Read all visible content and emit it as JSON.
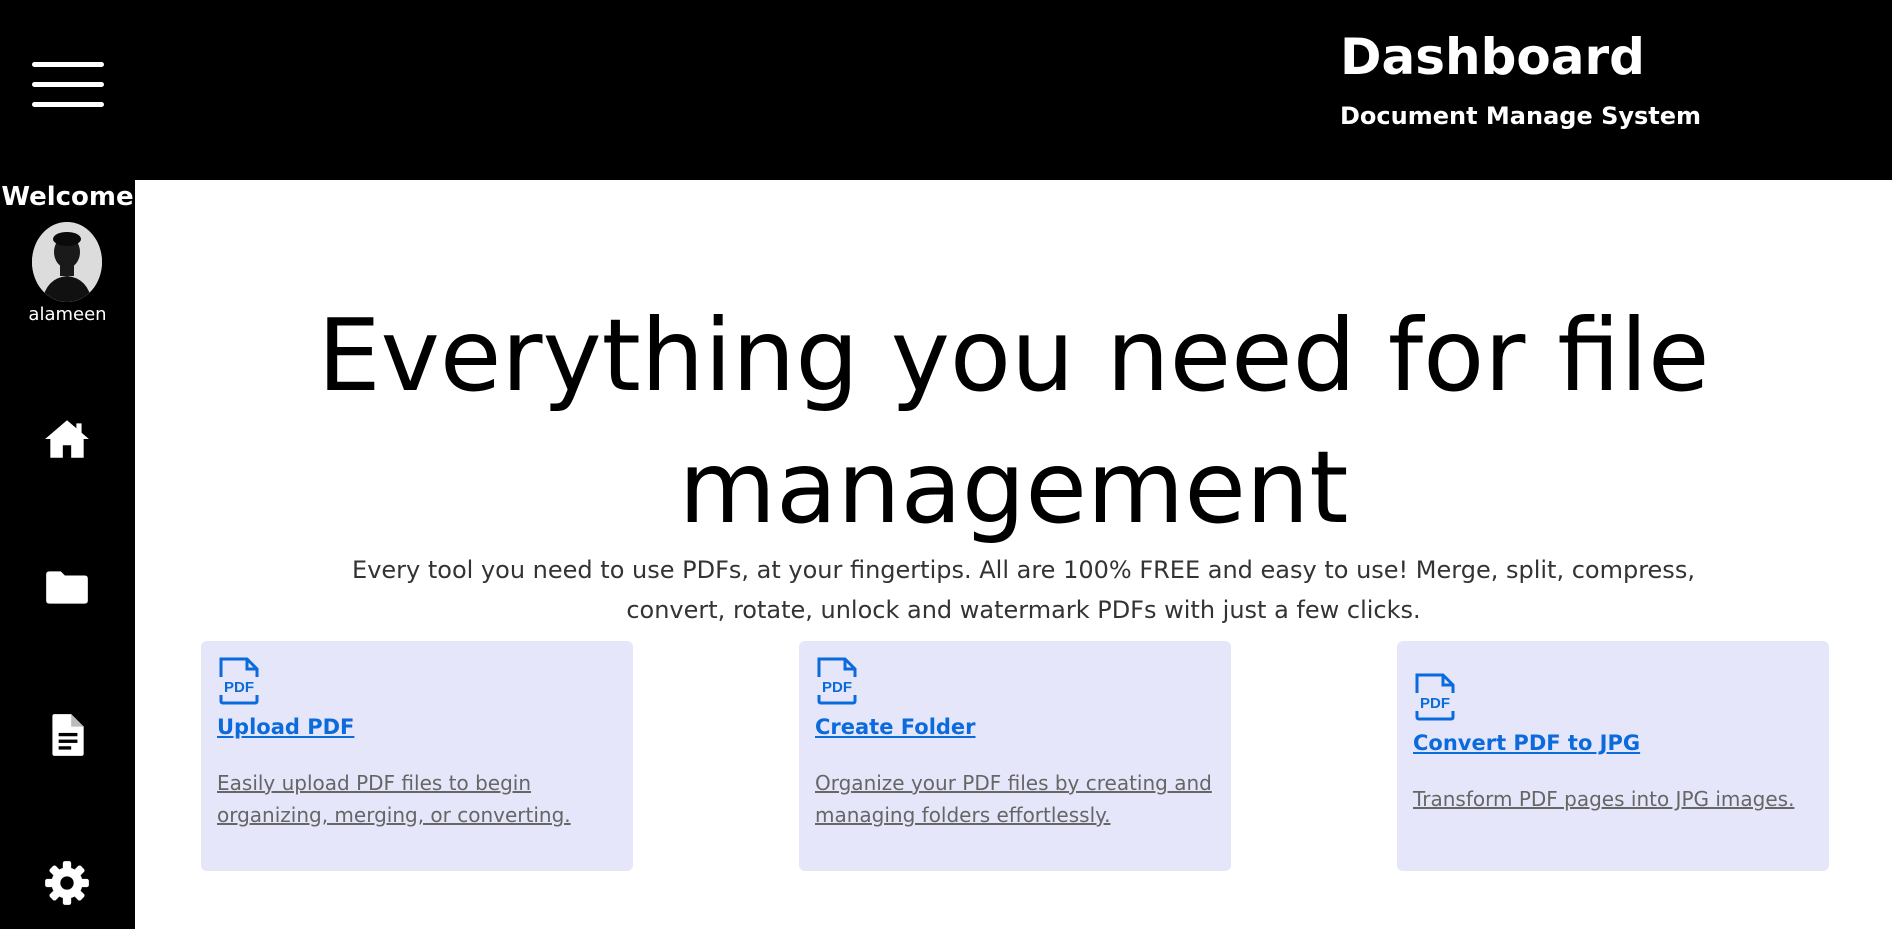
{
  "header": {
    "title": "Dashboard",
    "subtitle": "Document Manage System"
  },
  "sidebar": {
    "welcome": "Welcome",
    "username": "alameen",
    "icons": [
      "home-icon",
      "folder-icon",
      "document-icon",
      "settings-icon"
    ]
  },
  "hero": {
    "title": "Everything you need for file management",
    "description": "Every tool you need to use PDFs, at your fingertips. All are 100% FREE and easy to use! Merge, split, compress, convert, rotate, unlock and watermark PDFs with just a few clicks."
  },
  "cards": [
    {
      "icon": "pdf-icon",
      "title": "Upload PDF",
      "description": "Easily upload PDF files to begin organizing, merging, or converting."
    },
    {
      "icon": "pdf-icon",
      "title": "Create Folder",
      "description": "Organize your PDF files by creating and managing folders effortlessly."
    },
    {
      "icon": "pdf-icon",
      "title": "Convert PDF to JPG",
      "description": "Transform PDF pages into JPG images."
    }
  ],
  "colors": {
    "topbar": "#000000",
    "sidebar": "#000000",
    "card_background": "#e6e6fa",
    "link": "#0b6bdc",
    "description_text": "#666666"
  }
}
